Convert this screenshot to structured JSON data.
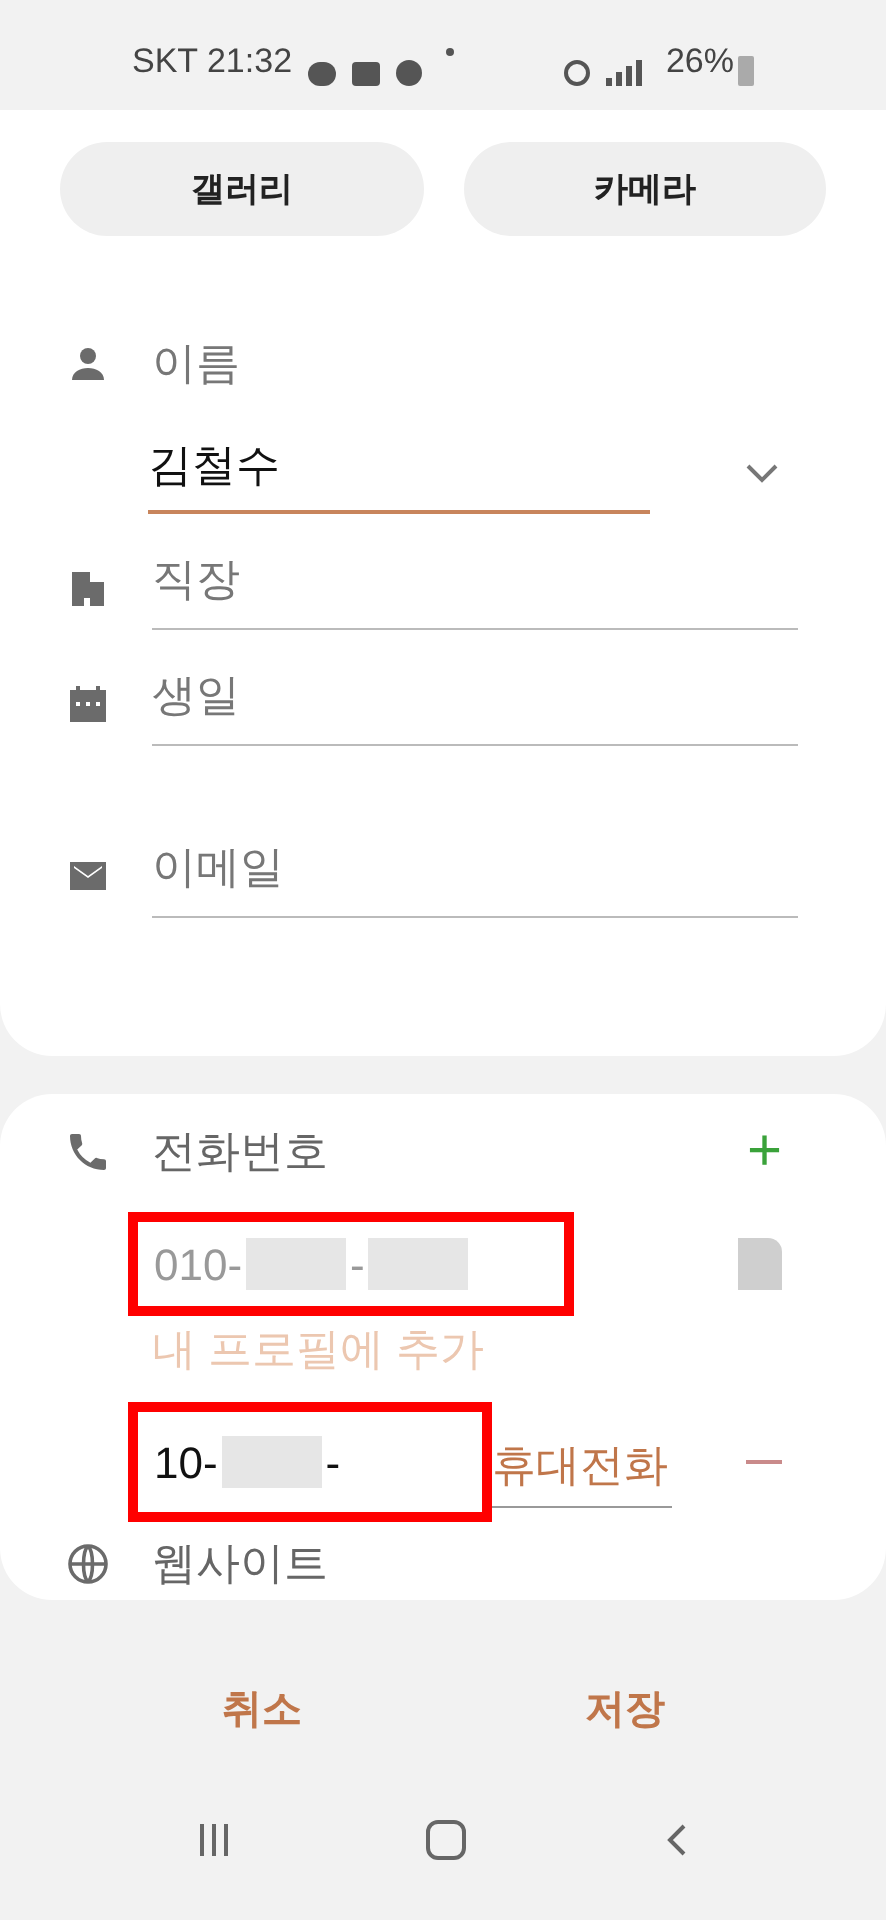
{
  "status_bar": {
    "carrier_time": "SKT 21:32",
    "battery": "26%"
  },
  "photo_buttons": [
    "갤러리",
    "카메라"
  ],
  "name_section": {
    "label": "이름",
    "value": "김철수",
    "expanded": false
  },
  "fields": [
    {
      "kind": "building",
      "placeholder": "직장"
    },
    {
      "kind": "calendar",
      "placeholder": "생일"
    },
    {
      "kind": "mail",
      "placeholder": "이메일"
    }
  ],
  "phone_section": {
    "label": "전화번호",
    "add": "+",
    "numbers": [
      {
        "kind": "sim",
        "parts": [
          "010-",
          "-"
        ],
        "add_link": "내 프로필에 추가"
      },
      {
        "kind": "editable",
        "parts": [
          "10-",
          "-"
        ],
        "type": "휴대전화"
      }
    ]
  },
  "website": {
    "label": "웹사이트"
  },
  "actions": [
    "취소",
    "저장"
  ]
}
